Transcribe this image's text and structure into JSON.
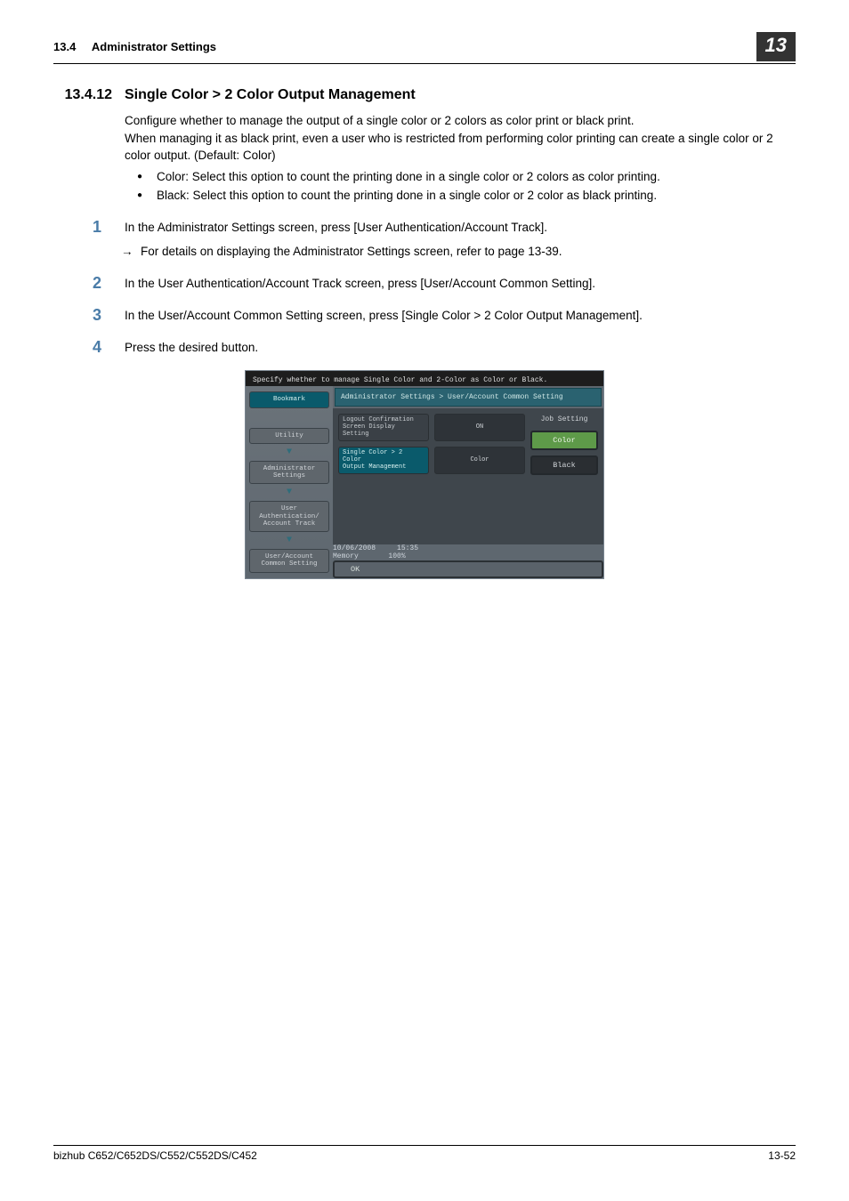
{
  "header": {
    "section_no": "13.4",
    "section_name": "Administrator Settings",
    "chapter_badge": "13"
  },
  "section": {
    "number": "13.4.12",
    "title": "Single Color > 2 Color Output Management"
  },
  "intro": {
    "p1": "Configure whether to manage the output of a single color or 2 colors as color print or black print.",
    "p2": "When managing it as black print, even a user who is restricted from performing color printing can create a single color or 2 color output. (Default: Color)"
  },
  "bullets": [
    "Color: Select this option to count the printing done in a single color or 2 colors as color printing.",
    "Black: Select this option to count the printing done in a single color or 2 color as black printing."
  ],
  "steps": [
    {
      "num": "1",
      "text": "In the Administrator Settings screen, press [User Authentication/Account Track].",
      "sub": "For details on displaying the Administrator Settings screen, refer to page 13-39."
    },
    {
      "num": "2",
      "text": "In the User Authentication/Account Track screen, press [User/Account Common Setting]."
    },
    {
      "num": "3",
      "text": "In the User/Account Common Setting screen, press [Single Color > 2 Color Output Management]."
    },
    {
      "num": "4",
      "text": "Press the desired button."
    }
  ],
  "device": {
    "prompt": "Specify whether to manage Single Color and 2-Color as Color or Black.",
    "breadcrumb": "Administrator Settings > User/Account Common Setting",
    "nav": {
      "bookmark": "Bookmark",
      "utility": "Utility",
      "admin": "Administrator\nSettings",
      "userauth": "User\nAuthentication/\nAccount Track",
      "common": "User/Account\nCommon Setting"
    },
    "rows": [
      {
        "label": "Logout Confirmation\nScreen Display Setting",
        "value": "ON",
        "selected": false
      },
      {
        "label": "Single Color > 2 Color\nOutput Management",
        "value": "Color",
        "selected": true
      }
    ],
    "right": {
      "job": "Job Setting",
      "opt1": "Color",
      "opt2": "Black"
    },
    "footer": {
      "date": "10/06/2008",
      "time": "15:35",
      "mem_label": "Memory",
      "mem_val": "100%",
      "ok": "OK"
    }
  },
  "page_footer": {
    "left": "bizhub C652/C652DS/C552/C552DS/C452",
    "right": "13-52"
  }
}
